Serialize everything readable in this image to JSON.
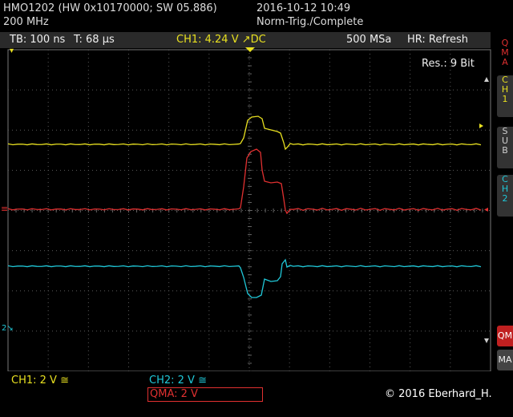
{
  "header": {
    "model": "HMO1202 (HW 0x10170000; SW 05.886)",
    "bandwidth": "200 MHz",
    "datetime": "2016-10-12 10:49",
    "status": "Norm-Trig./Complete"
  },
  "infobar": {
    "timebase": "TB: 100 ns",
    "trigger_time": "T: 68 µs",
    "trigger": "CH1: 4.24 V ↗DC",
    "sample_rate": "500 MSa",
    "mode": "HR: Refresh"
  },
  "resolution": "Res.: 9 Bit",
  "sidebar": {
    "tabs": [
      {
        "label": "QMA",
        "color": "#e03030"
      },
      {
        "label": "CH1",
        "color": "#e8e020"
      },
      {
        "label": "SUB",
        "color": "#cfcfcf"
      },
      {
        "label": "CH2",
        "color": "#20c8d8"
      }
    ],
    "bottom_tabs": [
      "QM",
      "MA"
    ]
  },
  "footer": {
    "ch1": "CH1: 2 V ≅",
    "ch2": "CH2: 2 V ≅",
    "qma": "QMA: 2 V",
    "copyright": "© 2016 Eberhard_H."
  },
  "colors": {
    "ch1": "#e8e020",
    "ch2": "#20c8d8",
    "qma": "#e03030",
    "grid": "#5a5a5a"
  }
}
